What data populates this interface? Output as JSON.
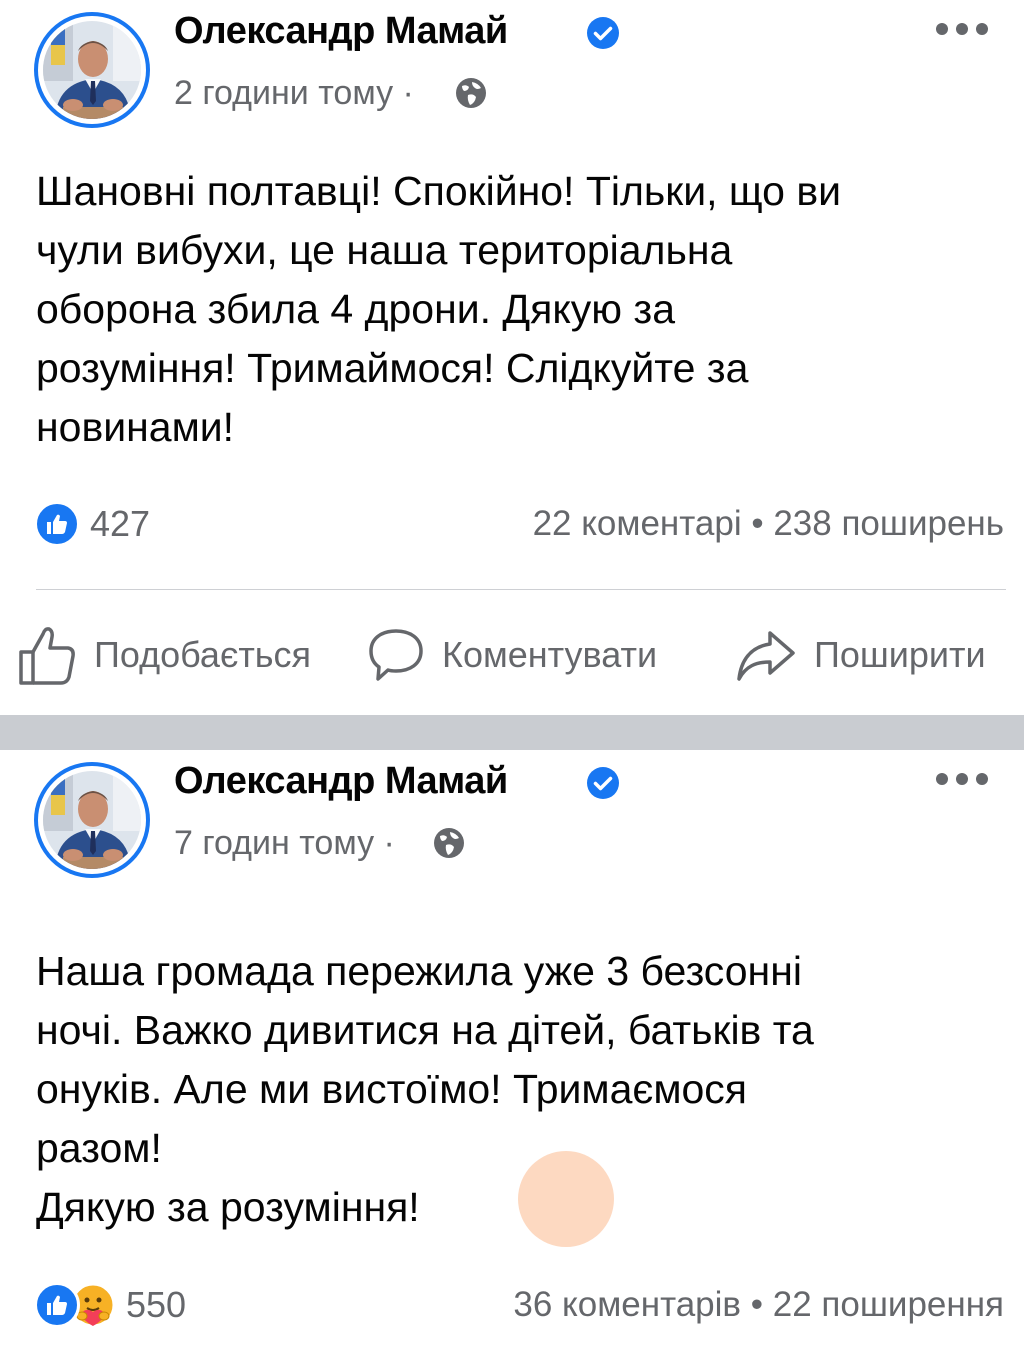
{
  "posts": [
    {
      "author": "Олександр Мамай",
      "time": "2 години тому",
      "separator": "·",
      "text": [
        "Шановні полтавці! Спокійно! Тільки, що ви",
        "чули вибухи, це наша територіальна",
        "оборона збила 4 дрони. Дякую за",
        "розуміння! Тримаймося! Слідкуйте за",
        "новинами!"
      ],
      "reactions_count": "427",
      "reaction_icons": [
        "like-icon"
      ],
      "comments": "22 коментарі",
      "dot": "•",
      "shares": "238 поширень",
      "actions": {
        "like": "Подобається",
        "comment": "Коментувати",
        "share": "Поширити"
      }
    },
    {
      "author": "Олександр Мамай",
      "time": "7 годин тому",
      "separator": "·",
      "text": [
        "Наша громада пережила уже 3 безсонні",
        "ночі. Важко дивитися на дітей, батьків та",
        "онуків. Але ми вистоїмо! Тримаємося",
        "разом!",
        "Дякую за розуміння!"
      ],
      "reactions_count": "550",
      "reaction_icons": [
        "like-icon",
        "care-icon"
      ],
      "comments": "36 коментарів",
      "dot": "•",
      "shares": "22 поширення"
    }
  ],
  "colors": {
    "accent": "#1877f2",
    "secondary_text": "#65676b",
    "separator": "#c9ccd1",
    "emoji_skin": "#fdd9c1"
  }
}
